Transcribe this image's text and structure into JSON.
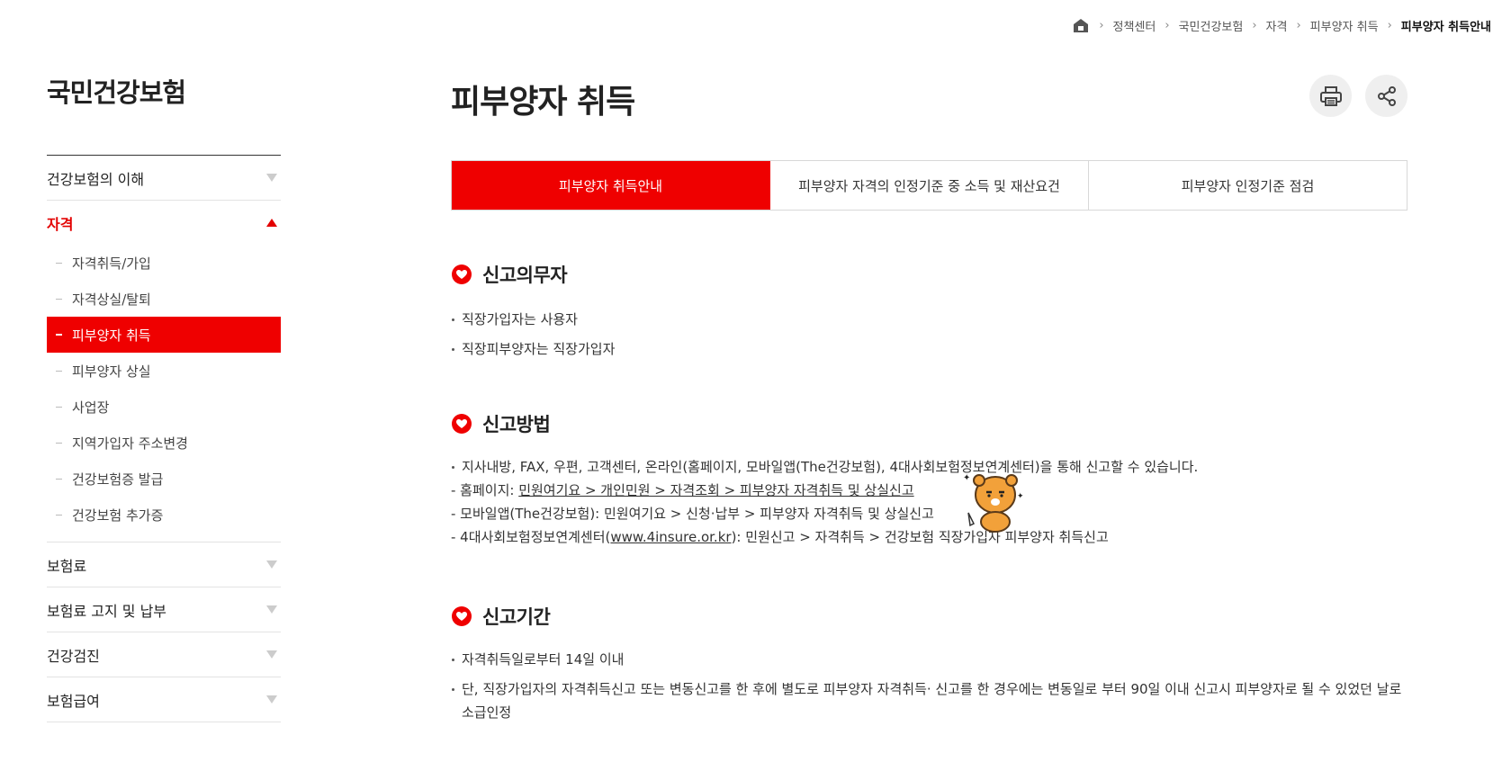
{
  "breadcrumb": {
    "home_icon": "home-icon",
    "items": [
      "정책센터",
      "국민건강보험",
      "자격",
      "피부양자 취득",
      "피부양자 취득안내"
    ]
  },
  "sidebar": {
    "title": "국민건강보험",
    "menu": [
      {
        "label": "건강보험의 이해",
        "expanded": false
      },
      {
        "label": "자격",
        "expanded": true,
        "items": [
          "자격취득/가입",
          "자격상실/탈퇴",
          "피부양자 취득",
          "피부양자 상실",
          "사업장",
          "지역가입자 주소변경",
          "건강보험증 발급",
          "건강보험 추가증"
        ]
      },
      {
        "label": "보험료",
        "expanded": false
      },
      {
        "label": "보험료 고지 및 납부",
        "expanded": false
      },
      {
        "label": "건강검진",
        "expanded": false
      },
      {
        "label": "보험급여",
        "expanded": false
      }
    ],
    "selected_item": "피부양자 취득"
  },
  "main": {
    "title": "피부양자 취득",
    "print_icon": "print-icon",
    "share_icon": "share-icon",
    "tabs": [
      "피부양자 취득안내",
      "피부양자 자격의 인정기준 중 소득 및 재산요건",
      "피부양자 인정기준 점검"
    ],
    "active_tab": 0,
    "sections": {
      "duty": {
        "title": "신고의무자",
        "bullets": [
          "직장가입자는 사용자",
          "직장피부양자는 직장가입자"
        ]
      },
      "method": {
        "title": "신고방법",
        "bullet": "지사내방, FAX, 우편, 고객센터, 온라인(홈페이지, 모바일앱(The건강보험), 4대사회보험정보연계센터)을 통해 신고할 수 있습니다.",
        "lines": {
          "homepage_prefix": "- 홈페이지: ",
          "homepage_link": "민원여기요 > 개인민원 > 자격조회 > 피부양자 자격취득 및 상실신고",
          "mobile": "- 모바일앱(The건강보험): 민원여기요 > 신청·납부 > 피부양자 자격취득 및 상실신고",
          "insure_prefix": "- 4대사회보험정보연계센터(",
          "insure_link": "www.4insure.or.kr",
          "insure_suffix": "): 민원신고 > 자격취득 > 건강보험 직장가입자 피부양자 취득신고"
        }
      },
      "period": {
        "title": "신고기간",
        "bullets": [
          "자격취득일로부터 14일 이내",
          "단, 직장가입자의 자격취득신고 또는 변동신고를 한 후에 별도로 피부양자 자격취득· 신고를 한 경우에는 변동일로 부터 90일 이내 신고시 피부양자로 될 수 있었던 날로 소급인정"
        ]
      }
    }
  },
  "colors": {
    "accent": "#ef0000",
    "active_menu": "#e30000",
    "button_bg": "#efefef"
  }
}
